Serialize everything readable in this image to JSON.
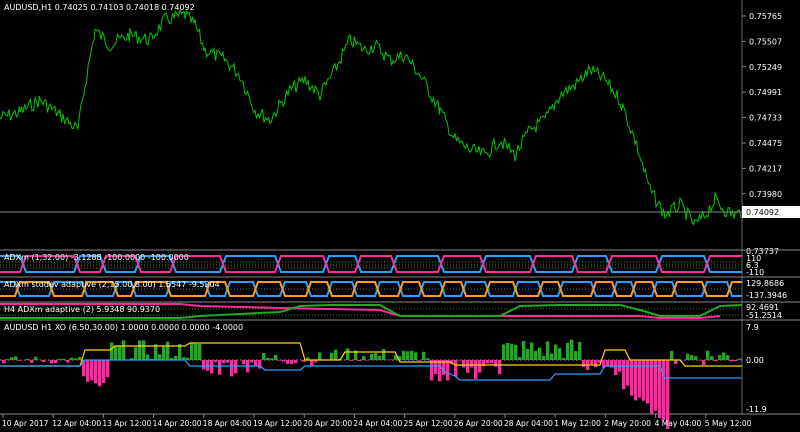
{
  "main": {
    "symbol_line": "AUDUSD,H1  0.74025 0.74103 0.74018 0.74092",
    "price_labels": [
      "0.75765",
      "0.75507",
      "0.75249",
      "0.74991",
      "0.74733",
      "0.74475",
      "0.74217",
      "0.73980"
    ],
    "current_price": "0.74092"
  },
  "panes": [
    {
      "title": "ADXm (1,32.00) -3.1288 -100.0000 -100.0000",
      "scale": [
        "110",
        "6.3",
        "-110"
      ]
    },
    {
      "title": "ADXm stddev adaptive (2,15.00,8.00) 1.5547 -9.5204",
      "scale": [
        "129.8686",
        "-137.3946"
      ]
    },
    {
      "title": "H4 ADXm adaptive (2) 5.9348 90.9370",
      "scale": [
        "92.4691",
        "-51.2514"
      ]
    },
    {
      "title": "AUDUSD H1 XO (6.50,30.00) 1.0000 0.0000 0.0000 -4.0000",
      "scale": [
        "7.9",
        "0.00",
        "-11.9"
      ]
    }
  ],
  "extra_scale": "0.73737",
  "time_labels": [
    "10 Apr 2017",
    "12 Apr 04:00",
    "13 Apr 12:00",
    "14 Apr 20:00",
    "18 Apr 04:00",
    "19 Apr 12:00",
    "20 Apr 20:00",
    "24 Apr 04:00",
    "25 Apr 12:00",
    "26 Apr 20:00",
    "28 Apr 04:00",
    "1 May 12:00",
    "2 May 20:00",
    "4 May 04:00",
    "5 May 12:00"
  ],
  "colors": {
    "price": "#00c800",
    "pink": "#ff2aa0",
    "blue": "#2aa0ff",
    "orange": "#ff9a1e",
    "green": "#22a822",
    "yellow": "#ffd400",
    "dots": "#3a8a3a"
  }
}
